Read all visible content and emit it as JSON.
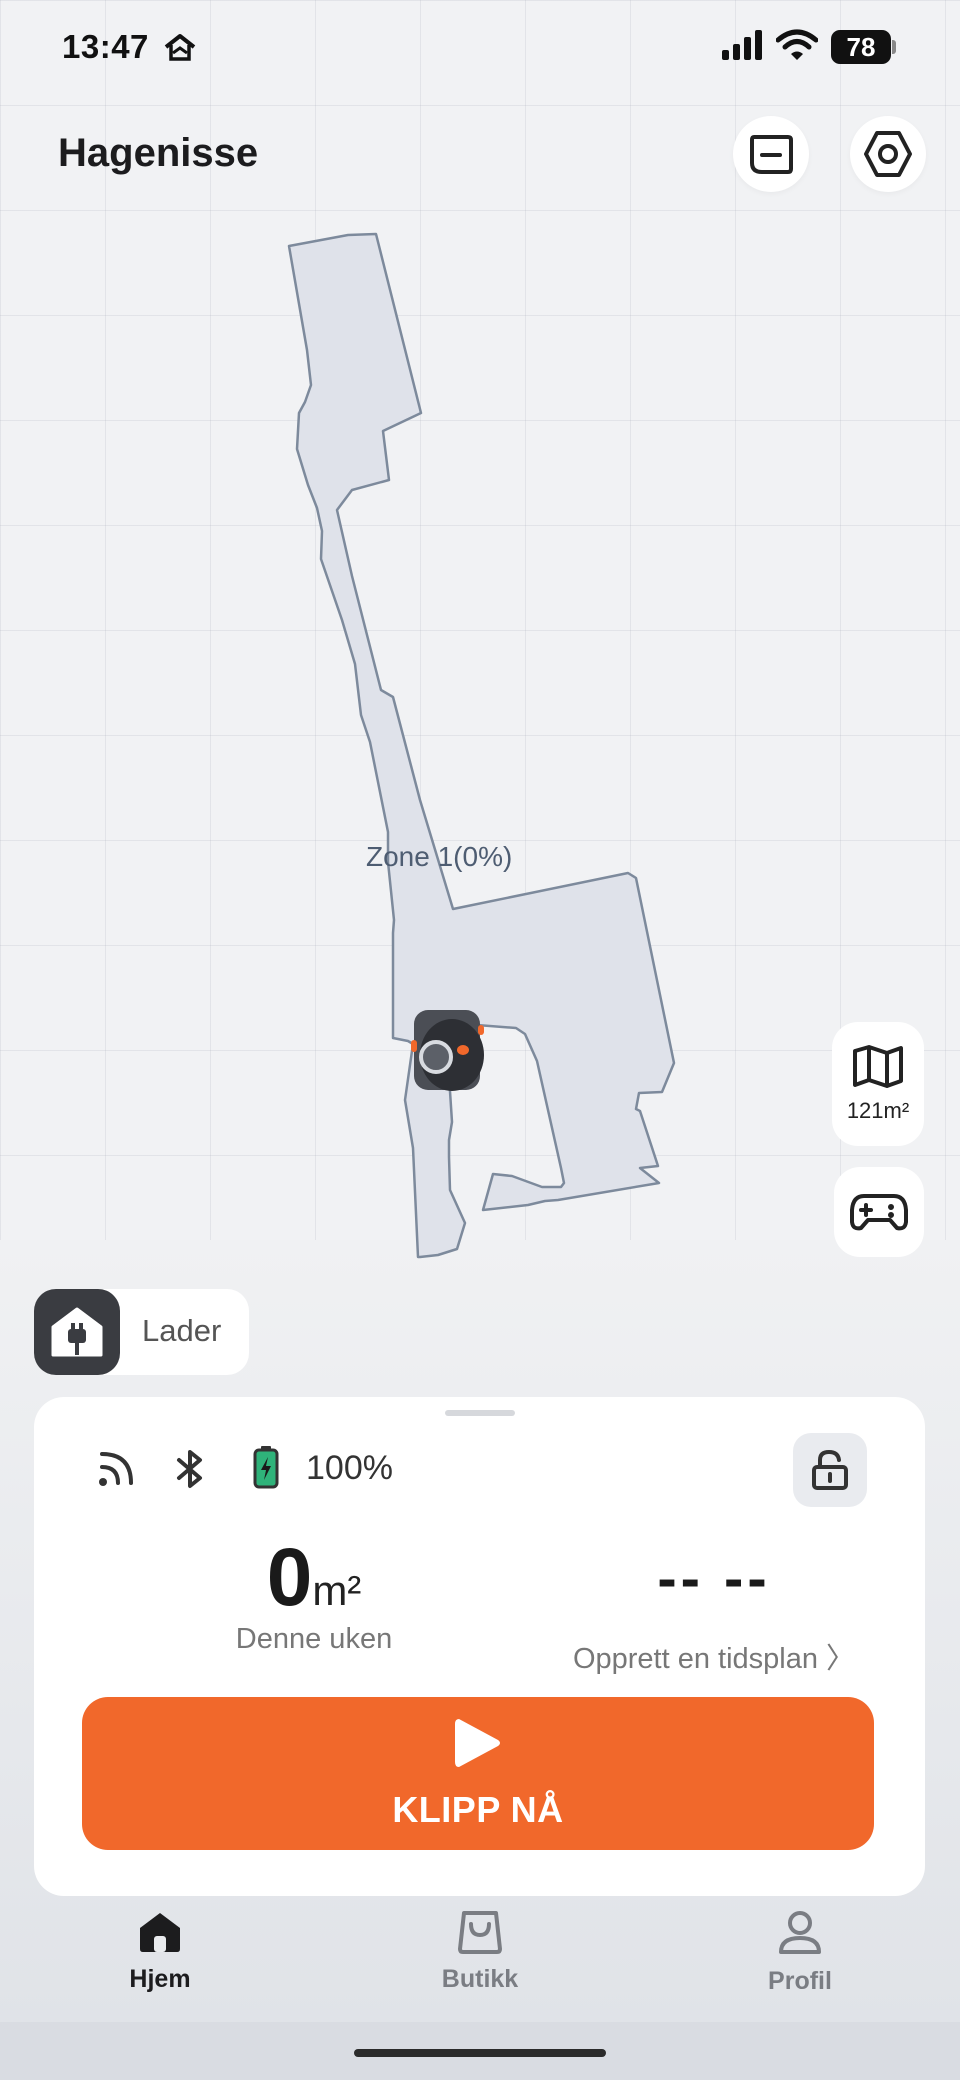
{
  "status_bar": {
    "time": "13:47",
    "battery_level": "78",
    "icons": [
      "home-status-icon",
      "cellular-signal-icon",
      "wifi-icon",
      "battery-icon"
    ]
  },
  "header": {
    "title": "Hagenisse",
    "buttons": [
      "message-icon",
      "settings-icon"
    ]
  },
  "map": {
    "zone_label": "Zone 1(0%)",
    "map_area": "121m²",
    "zone_fill": "#dfe2ea",
    "zone_stroke": "#7d8a9c"
  },
  "charger": {
    "label": "Lader"
  },
  "panel": {
    "battery_percent": "100%",
    "connection_icons": [
      "cellular-data-icon",
      "bluetooth-icon",
      "battery-charging-icon"
    ],
    "lock_icon": "unlock-icon",
    "area_value": "0",
    "area_unit": "m²",
    "area_caption": "Denne uken",
    "schedule_value": "-- --",
    "schedule_caption": "Opprett en tidsplan 〉",
    "start_label": "KLIPP NÅ",
    "accent_color": "#f1682b"
  },
  "tabs": [
    {
      "label": "Hjem",
      "icon": "home-icon",
      "active": true
    },
    {
      "label": "Butikk",
      "icon": "shopping-bag-icon",
      "active": false
    },
    {
      "label": "Profil",
      "icon": "profile-icon",
      "active": false
    }
  ]
}
